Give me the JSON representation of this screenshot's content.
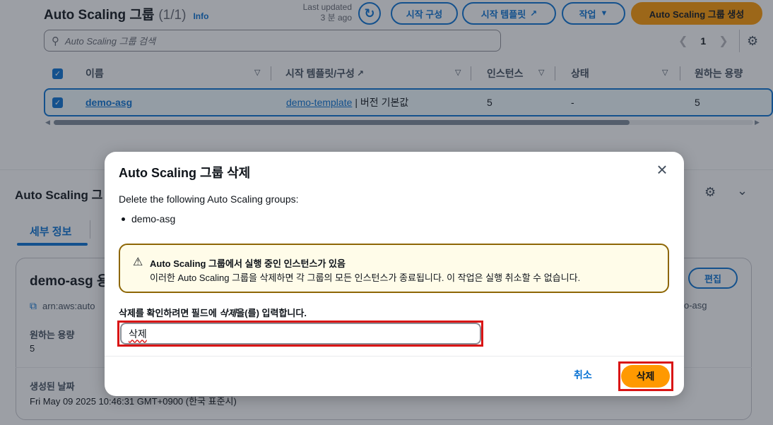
{
  "header": {
    "title": "Auto Scaling 그룹",
    "count": "(1/1)",
    "info": "Info",
    "last_updated_label": "Last updated",
    "last_updated_value": "3 분 ago",
    "buttons": {
      "launch_config": "시작 구성",
      "launch_template": "시작 템플릿",
      "actions": "작업",
      "create": "Auto Scaling 그룹 생성"
    }
  },
  "search": {
    "placeholder": "Auto Scaling 그룹 검색"
  },
  "pagination": {
    "page": "1"
  },
  "table": {
    "columns": [
      "이름",
      "시작 템플릿/구성",
      "인스턴스",
      "상태",
      "원하는 용량"
    ],
    "rows": [
      {
        "name": "demo-asg",
        "template": "demo-template",
        "template_suffix": "| 버전 기본값",
        "instances": "5",
        "status": "-",
        "desired": "5"
      }
    ]
  },
  "details": {
    "panel_title": "Auto Scaling 그",
    "tab": "세부 정보",
    "card_title": "demo-asg 용",
    "arn_prefix": "arn:aws:auto",
    "arn_tail": "o-asg",
    "edit": "편집",
    "desired_label": "원하는 용량",
    "desired_value": "5",
    "created_label": "생성된 날짜",
    "created_value": "Fri May 09 2025 10:46:31 GMT+0900 (한국 표준시)"
  },
  "modal": {
    "title": "Auto Scaling 그룹 삭제",
    "description": "Delete the following Auto Scaling groups:",
    "items": [
      "demo-asg"
    ],
    "warning_title": "Auto Scaling 그룹에서 실행 중인 인스턴스가 있음",
    "warning_text": "이러한 Auto Scaling 그룹을 삭제하면 각 그룹의 모든 인스턴스가 종료됩니다. 이 작업은 실행 취소할 수 없습니다.",
    "confirm_prefix": "삭제를 확인하려면 필드에 ",
    "confirm_keyword": "삭제",
    "confirm_suffix": "을(를) 입력합니다.",
    "input_value": "삭제",
    "cancel": "취소",
    "delete": "삭제"
  },
  "colors": {
    "accent": "#0972d3",
    "primary_button": "#ff9900",
    "highlight_outline": "#d91515",
    "warning_border": "#8d6605"
  },
  "icons": [
    "refresh-icon",
    "external-link-icon",
    "caret-down-icon",
    "search-icon",
    "chevron-left-icon",
    "chevron-right-icon",
    "gear-icon",
    "sort-icon",
    "check-icon",
    "copy-icon",
    "close-icon",
    "warning-icon"
  ]
}
